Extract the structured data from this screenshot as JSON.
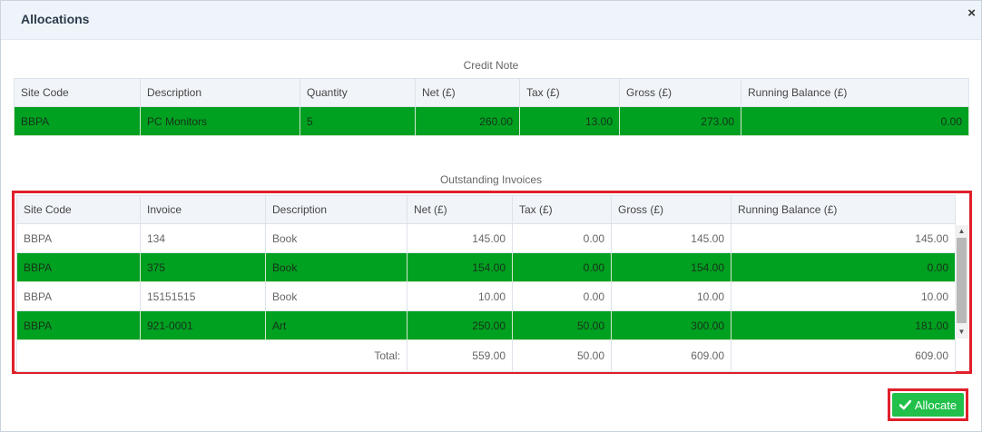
{
  "dialog": {
    "title": "Allocations",
    "close_icon": "×"
  },
  "credit_note": {
    "title": "Credit Note",
    "columns": [
      "Site Code",
      "Description",
      "Quantity",
      "Net (£)",
      "Tax (£)",
      "Gross (£)",
      "Running Balance (£)"
    ],
    "rows": [
      {
        "site_code": "BBPA",
        "description": "PC Monitors",
        "quantity": "5",
        "net": "260.00",
        "tax": "13.00",
        "gross": "273.00",
        "running_balance": "0.00",
        "allocated": true
      }
    ]
  },
  "outstanding_invoices": {
    "title": "Outstanding Invoices",
    "columns": [
      "Site Code",
      "Invoice",
      "Description",
      "Net (£)",
      "Tax (£)",
      "Gross (£)",
      "Running Balance (£)"
    ],
    "rows": [
      {
        "site_code": "BBPA",
        "invoice": "134",
        "description": "Book",
        "net": "145.00",
        "tax": "0.00",
        "gross": "145.00",
        "running_balance": "145.00",
        "allocated": false
      },
      {
        "site_code": "BBPA",
        "invoice": "375",
        "description": "Book",
        "net": "154.00",
        "tax": "0.00",
        "gross": "154.00",
        "running_balance": "0.00",
        "allocated": true
      },
      {
        "site_code": "BBPA",
        "invoice": "15151515",
        "description": "Book",
        "net": "10.00",
        "tax": "0.00",
        "gross": "10.00",
        "running_balance": "10.00",
        "allocated": false
      },
      {
        "site_code": "BBPA",
        "invoice": "921-0001",
        "description": "Art",
        "net": "250.00",
        "tax": "50.00",
        "gross": "300.00",
        "running_balance": "181.00",
        "allocated": true
      }
    ],
    "totals": {
      "label": "Total:",
      "net": "559.00",
      "tax": "50.00",
      "gross": "609.00",
      "running_balance": "609.00"
    }
  },
  "actions": {
    "allocate_label": "Allocate",
    "allocate_icon": "check-icon"
  },
  "colors": {
    "allocated_row": "#00a020",
    "allocate_button": "#21c04a",
    "highlight_border": "#e0202a"
  }
}
